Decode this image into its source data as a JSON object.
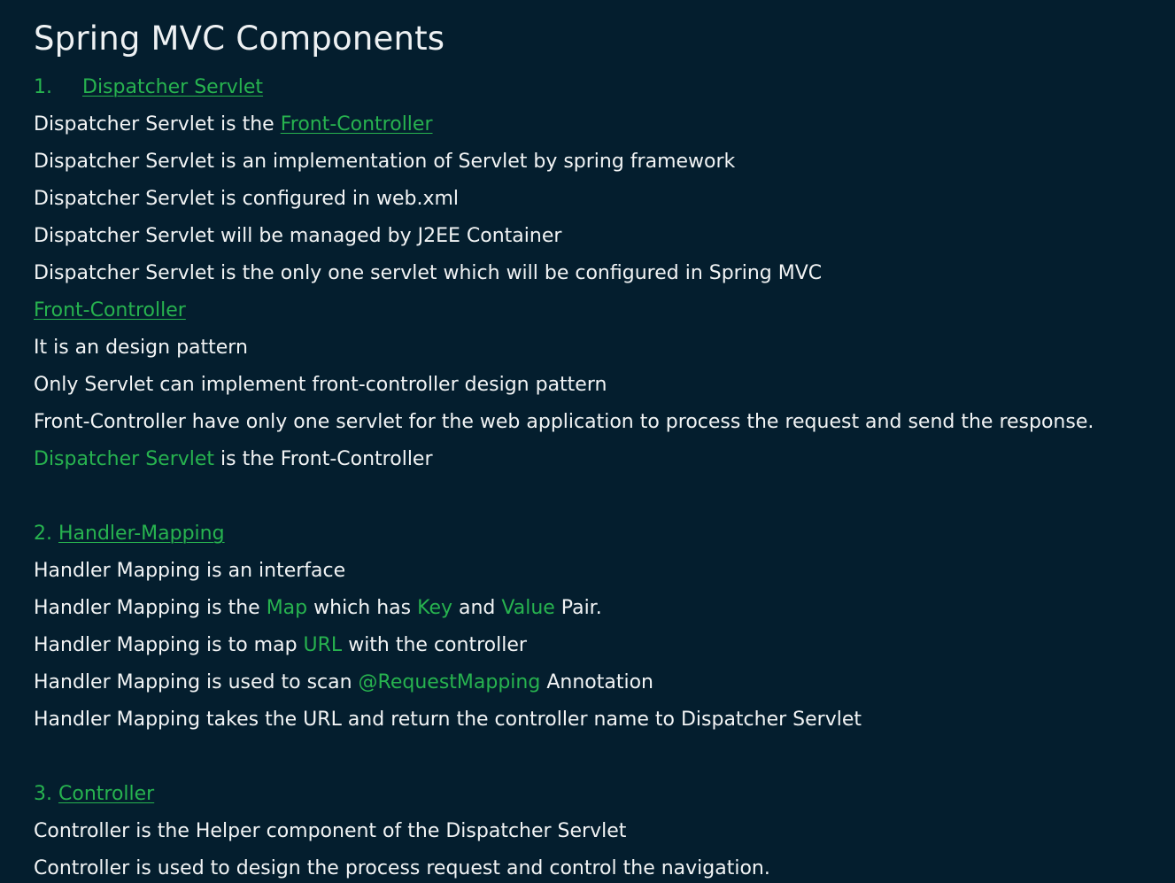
{
  "colors": {
    "background": "#041e2e",
    "text": "#f2f4f5",
    "accent": "#27b34f"
  },
  "title": "Spring MVC Components",
  "s1": {
    "number": "1.",
    "heading": "Dispatcher Servlet",
    "l1": {
      "pre": "Dispatcher Servlet is the ",
      "link": "Front-Controller"
    },
    "l2": "Dispatcher Servlet is an implementation of Servlet by spring framework",
    "l3": "Dispatcher Servlet is configured in web.xml",
    "l4": "Dispatcher Servlet will be managed by J2EE Container",
    "l5": "Dispatcher Servlet is the only one servlet which will be configured in Spring MVC",
    "fc_heading": "Front-Controller",
    "l6": "It is an design pattern",
    "l7": "Only Servlet can implement front-controller design pattern",
    "l8": "Front-Controller have only one servlet for the web application to process the request and send the response.",
    "l9": {
      "accent": "Dispatcher Servlet",
      "post": " is the Front-Controller"
    }
  },
  "s2": {
    "number": "2.",
    "heading": "Handler-Mapping",
    "l1": "Handler Mapping is an interface",
    "l2": {
      "a": "Handler Mapping is the ",
      "map": "Map",
      "b": " which has ",
      "key": "Key",
      "c": " and ",
      "value": "Value",
      "d": " Pair."
    },
    "l3": {
      "a": "Handler Mapping is to map ",
      "url": "URL",
      "b": " with the controller"
    },
    "l4": {
      "a": "Handler Mapping is used to scan ",
      "anno": "@RequestMapping",
      "b": " Annotation"
    },
    "l5": "Handler Mapping takes the URL and return the controller name to Dispatcher Servlet"
  },
  "s3": {
    "number": "3.",
    "heading": "Controller",
    "l1": "Controller is the Helper component of the Dispatcher Servlet",
    "l2": "Controller is used to design the process request and control the navigation."
  }
}
